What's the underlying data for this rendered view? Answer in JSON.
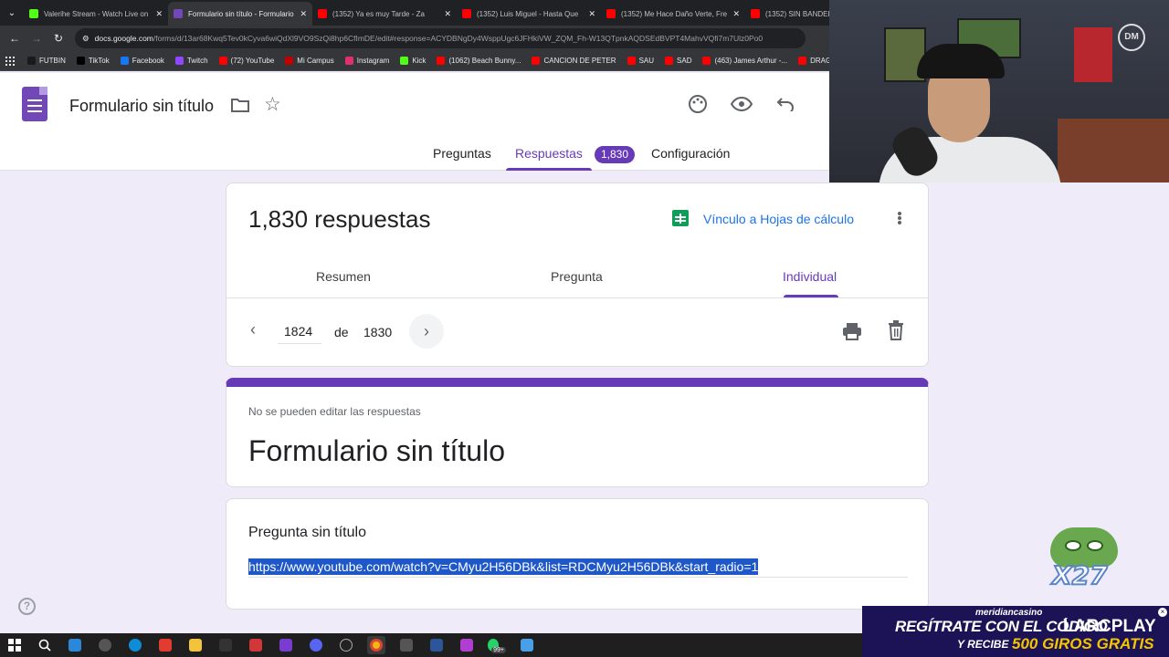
{
  "browser": {
    "tabs": [
      {
        "label": "Valerihe Stream - Watch Live on",
        "color": "#53fc18",
        "active": false
      },
      {
        "label": "Formulario sin título - Formulario",
        "color": "#7248b9",
        "active": true
      },
      {
        "label": "(1352) Ya es muy Tarde - Za",
        "color": "#ff0000",
        "active": false
      },
      {
        "label": "(1352) Luis Miguel - Hasta Que",
        "color": "#ff0000",
        "active": false
      },
      {
        "label": "(1352) Me Hace Daño Verte, Fre",
        "color": "#ff0000",
        "active": false
      },
      {
        "label": "(1352) SIN BANDER",
        "color": "#ff0000",
        "active": false
      }
    ],
    "url_host": "docs.google.com",
    "url_path": "/forms/d/13ar68Kwq5Tev0kCyva6wiQdXl9VO9SzQi8hp6CfImDE/edit#response=ACYDBNgDy4WsppUgc6JFHkiVW_ZQM_Fh-W13QTpnkAQDSEdBVPT4MahvVQfi7m7Ulz0Po0",
    "bookmarks": [
      {
        "label": "FUTBIN",
        "color": "#1a1a1a"
      },
      {
        "label": "TikTok",
        "color": "#000000"
      },
      {
        "label": "Facebook",
        "color": "#1877f2"
      },
      {
        "label": "Twitch",
        "color": "#9146ff"
      },
      {
        "label": "(72) YouTube",
        "color": "#ff0000"
      },
      {
        "label": "Mi Campus",
        "color": "#c00000"
      },
      {
        "label": "Instagram",
        "color": "#e1306c"
      },
      {
        "label": "Kick",
        "color": "#53fc18"
      },
      {
        "label": "(1062) Beach Bunny...",
        "color": "#ff0000"
      },
      {
        "label": "CANCION DE PETER",
        "color": "#ff0000"
      },
      {
        "label": "SAU",
        "color": "#ff0000"
      },
      {
        "label": "SAD",
        "color": "#ff0000"
      },
      {
        "label": "(463) James Arthur -...",
        "color": "#ff0000"
      },
      {
        "label": "DRAGO",
        "color": "#ff0000"
      }
    ]
  },
  "header": {
    "title": "Formulario sin título",
    "tabs": {
      "preguntas": "Preguntas",
      "respuestas": "Respuestas",
      "configuracion": "Configuración"
    },
    "response_badge": "1,830"
  },
  "summary": {
    "count_text": "1,830 respuestas",
    "sheets_link": "Vínculo a Hojas de cálculo",
    "subtabs": {
      "resumen": "Resumen",
      "pregunta": "Pregunta",
      "individual": "Individual"
    },
    "pager": {
      "current": "1824",
      "of_label": "de",
      "total": "1830"
    }
  },
  "form": {
    "notice": "No se pueden editar las respuestas",
    "title": "Formulario sin título"
  },
  "question": {
    "title": "Pregunta sin título",
    "answer": "https://www.youtube.com/watch?v=CMyu2H56DBk&list=RDCMyu2H56DBk&start_radio=1"
  },
  "overlay": {
    "webcam_logo": "DM",
    "pepe_text": "X27",
    "casino": {
      "name": "meridiancasino",
      "line1": "REGÍTRATE CON EL CÓDIGO",
      "code": "LARCPLAY",
      "line2a": "Y RECIBE",
      "line2b": "500 GIROS GRATIS"
    }
  },
  "taskbar": {
    "whatsapp_badge": "99+"
  },
  "colors": {
    "accent": "#673ab7",
    "link": "#1a73e8",
    "page_bg": "#f0ebf8"
  }
}
